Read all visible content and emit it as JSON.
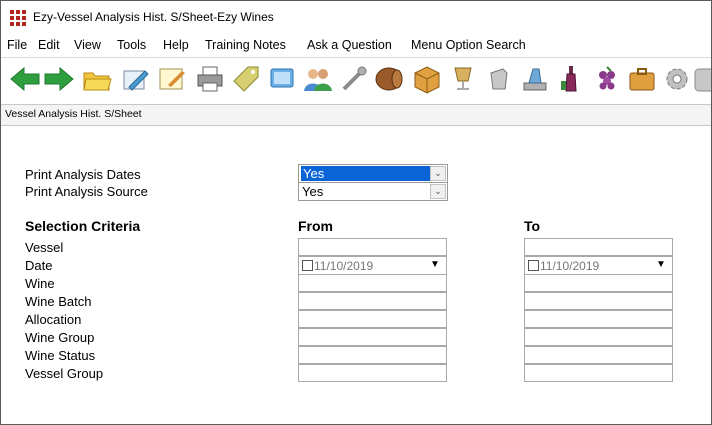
{
  "window": {
    "title": "Ezy-Vessel Analysis Hist. S/Sheet-Ezy Wines"
  },
  "menu": [
    "File",
    "Edit",
    "View",
    "Tools",
    "Help",
    "Training Notes",
    "Ask a Question",
    "Menu Option Search"
  ],
  "toolbar_icons": [
    "back-arrow-icon",
    "forward-arrow-icon",
    "folder-icon",
    "edit-icon",
    "note-icon",
    "printer-icon",
    "tag-icon",
    "screen-icon",
    "users-icon",
    "tools-icon",
    "barrel-icon",
    "box-icon",
    "glass-icon",
    "pourer-icon",
    "lab-icon",
    "bottle-icon",
    "grapes-icon",
    "briefcase-icon",
    "settings-icon",
    "cylinder-icon"
  ],
  "colors": {
    "title_icon": "#b3261e",
    "selection": "#0a64d6",
    "arrow": "#2e9e3e"
  },
  "caption": "Vessel Analysis Hist. S/Sheet",
  "options": {
    "print_dates_label": "Print Analysis Dates",
    "print_dates_value": "Yes",
    "print_source_label": "Print Analysis Source",
    "print_source_value": "Yes"
  },
  "criteria": {
    "heading": "Selection Criteria",
    "from_label": "From",
    "to_label": "To",
    "rows": [
      "Vessel",
      "Date",
      "Wine",
      "Wine Batch",
      "Allocation",
      "Wine Group",
      "Wine Status",
      "Vessel Group"
    ],
    "date_from": "11/10/2019",
    "date_to": "11/10/2019"
  }
}
